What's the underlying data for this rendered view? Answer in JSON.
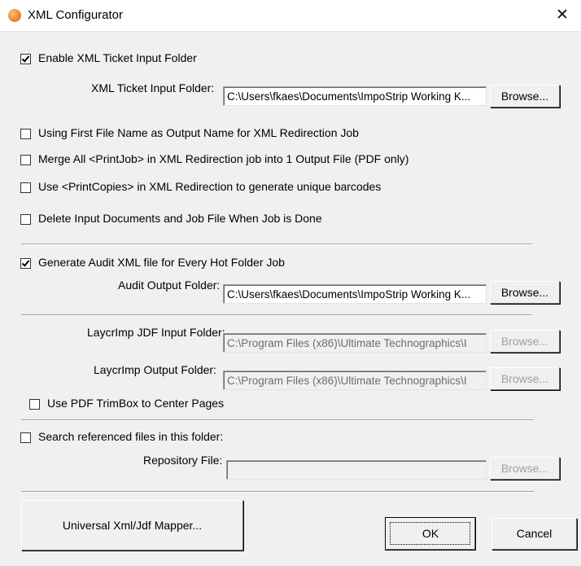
{
  "window": {
    "title": "XML Configurator",
    "close_glyph": "✕"
  },
  "xml_ticket": {
    "enable_label": "Enable XML Ticket Input Folder",
    "enable_checked": true,
    "folder_label": "XML Ticket Input Folder:",
    "folder_value": "C:\\Users\\fkaes\\Documents\\ImpoStrip Working K...",
    "browse_label": "Browse..."
  },
  "options": [
    {
      "label": "Using First File Name as Output Name for XML Redirection Job",
      "checked": false
    },
    {
      "label": "Merge All <PrintJob> in XML Redirection job into 1 Output File (PDF only)",
      "checked": false
    },
    {
      "label": "Use <PrintCopies> in XML Redirection to generate unique barcodes",
      "checked": false
    },
    {
      "label": "Delete Input Documents and Job File When Job is Done",
      "checked": false
    }
  ],
  "audit": {
    "enable_label": "Generate Audit XML file for Every Hot Folder Job",
    "enable_checked": true,
    "folder_label": "Audit Output Folder:",
    "folder_value": "C:\\Users\\fkaes\\Documents\\ImpoStrip Working K...",
    "browse_label": "Browse..."
  },
  "layerimp": {
    "input_label": "LaycrImp JDF Input Folder:",
    "input_value": "C:\\Program Files (x86)\\Ultimate Technographics\\I",
    "input_browse": "Browse...",
    "output_label": "LaycrImp Output Folder:",
    "output_value": "C:\\Program Files (x86)\\Ultimate Technographics\\I",
    "output_browse": "Browse...",
    "trimbox_label": "Use PDF TrimBox to Center Pages",
    "trimbox_checked": false
  },
  "repository": {
    "search_label": "Search referenced files in this folder:",
    "search_checked": false,
    "file_label": "Repository File:",
    "file_value": "",
    "browse_label": "Browse..."
  },
  "footer": {
    "mapper_label": "Universal Xml/Jdf Mapper...",
    "ok_label": "OK",
    "cancel_label": "Cancel"
  },
  "colors": {
    "dialog_bg": "#f0f0f0",
    "titlebar_bg": "#ffffff",
    "app_icon": "#f28a2e"
  }
}
